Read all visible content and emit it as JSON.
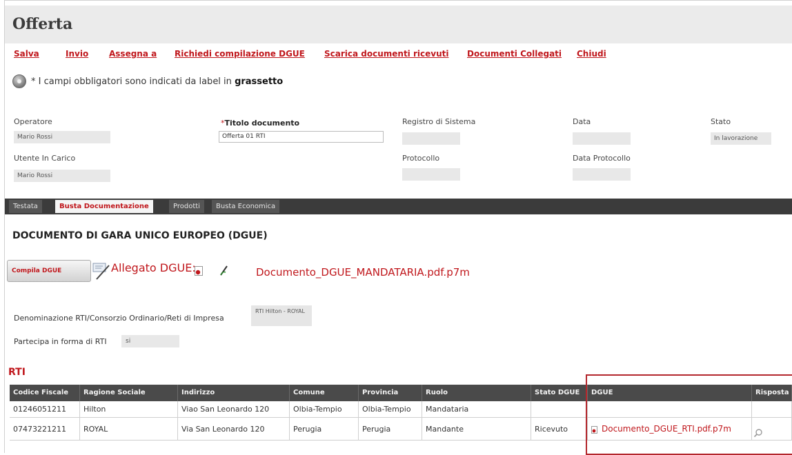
{
  "window": {
    "title": "Offerta"
  },
  "toolbar": {
    "save": "Salva",
    "send": "Invio",
    "assign": "Assegna a",
    "request_dgue": "Richiedi compilazione DGUE",
    "download_docs": "Scarica documenti ricevuti",
    "linked_docs": "Documenti Collegati",
    "close": "Chiudi"
  },
  "info": {
    "text_prefix": "* I campi obbligatori sono indicati da label in",
    "text_bold": "grassetto"
  },
  "form": {
    "operatore_label": "Operatore",
    "operatore_value": "Mario Rossi",
    "titolo_required_mark": "*",
    "titolo_label": "Titolo documento",
    "titolo_value": "Offerta 01 RTI",
    "registro_label": "Registro di Sistema",
    "registro_value": "",
    "data_label": "Data",
    "data_value": "",
    "stato_label": "Stato",
    "stato_value": "In lavorazione",
    "utente_label": "Utente In Carico",
    "utente_value": "Mario Rossi",
    "protocollo_label": "Protocollo",
    "protocollo_value": "",
    "data_protocollo_label": "Data Protocollo",
    "data_protocollo_value": ""
  },
  "tabs": [
    "Testata",
    "Busta Documentazione",
    "Prodotti",
    "Busta Economica"
  ],
  "active_tab": "Busta Documentazione",
  "dgue": {
    "section_title": "DOCUMENTO DI GARA UNICO EUROPEO (DGUE)",
    "compile_button": "Compila DGUE",
    "attachment_label": "Allegato DGUE:",
    "attachment_file": "Documento_DGUE_MANDATARIA.pdf.p7m"
  },
  "rti_info": {
    "denominazione_label": "Denominazione RTI/Consorzio Ordinario/Reti di Impresa",
    "denominazione_value": "RTI Hilton - ROYAL",
    "partecipa_label": "Partecipa in forma di RTI",
    "partecipa_value": "si"
  },
  "rti_table": {
    "title": "RTI",
    "columns": [
      "Codice Fiscale",
      "Ragione Sociale",
      "Indirizzo",
      "Comune",
      "Provincia",
      "Ruolo",
      "Stato DGUE",
      "DGUE",
      "Risposta"
    ],
    "rows": [
      {
        "codice": "01246051211",
        "ragione": "Hilton",
        "indirizzo": "Viao San Leonardo 120",
        "comune": "Olbia-Tempio",
        "provincia": "Olbia-Tempio",
        "ruolo": "Mandataria",
        "stato": "",
        "dgue": "",
        "risposta": ""
      },
      {
        "codice": "07473221211",
        "ragione": "ROYAL",
        "indirizzo": "Via San Leonardo 120",
        "comune": "Perugia",
        "provincia": "Perugia",
        "ruolo": "Mandante",
        "stato": "Ricevuto",
        "dgue": "Documento_DGUE_RTI.pdf.p7m",
        "risposta": ""
      }
    ]
  },
  "colors": {
    "accent_red": "#c0171c",
    "tab_bar": "#3b3b3b",
    "header_bg": "#ebebeb",
    "highlight_border": "#b3262c"
  },
  "icons": [
    "info-icon",
    "compile-dgue-icon",
    "pdf-icon",
    "sign-icon",
    "search-icon"
  ]
}
